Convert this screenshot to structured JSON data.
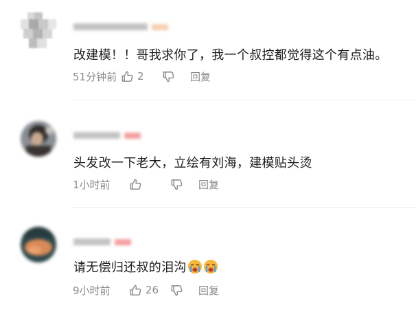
{
  "comments": [
    {
      "text": "改建模！！哥我求你了，我一个叔控都觉得这个有点油。",
      "time": "51分钟前",
      "likes": "2",
      "reply": "回复",
      "badge_color": "#f5c7a3"
    },
    {
      "text": "头发改一下老大，立绘有刘海，建模贴头烫",
      "time": "1小时前",
      "likes": "",
      "reply": "回复",
      "badge_color": "#f28e8e"
    },
    {
      "text": "请无偿归还叔的泪沟",
      "time": "9小时前",
      "likes": "26",
      "reply": "回复",
      "badge_color": "#f28e8e"
    }
  ],
  "icons": {
    "like": "thumbs-up-icon",
    "dislike": "thumbs-down-icon",
    "emoji": "crying-face-emoji"
  },
  "colors": {
    "meta_text": "#8a8a8a",
    "body_text": "#1c1c1c",
    "divider": "#ececec"
  }
}
